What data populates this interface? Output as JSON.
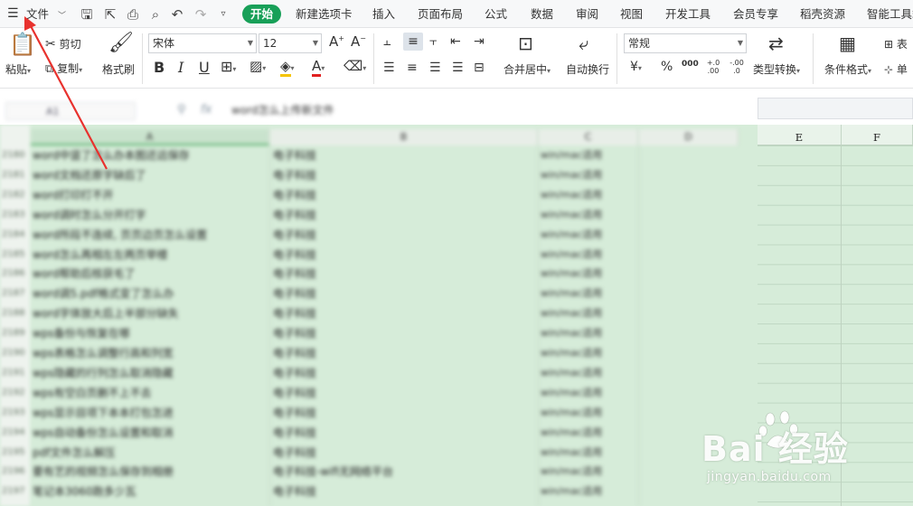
{
  "menubar": {
    "file_label": "文件",
    "tabs": [
      "开始",
      "新建选项卡",
      "插入",
      "页面布局",
      "公式",
      "数据",
      "审阅",
      "视图",
      "开发工具",
      "会员专享",
      "稻壳资源",
      "智能工具箱"
    ],
    "active_tab_color": "#18a058"
  },
  "ribbon": {
    "clipboard": {
      "paste": "粘贴",
      "cut": "剪切",
      "copy": "复制",
      "format_painter": "格式刷"
    },
    "font": {
      "family": "宋体",
      "size": "12",
      "bold": "B",
      "italic": "I",
      "underline": "U"
    },
    "alignment": {
      "merge_center": "合并居中",
      "wrap_text": "自动换行"
    },
    "number": {
      "format": "常规",
      "currency": "¥",
      "percent": "%",
      "thousands": "000",
      "inc_decimal": "+.0 .00",
      "dec_decimal": "-.00 .0",
      "type_convert": "类型转换"
    },
    "styles": {
      "conditional_format": "条件格式",
      "table_style": "表",
      "cell_style": "单"
    }
  },
  "formula": {
    "name_box": "A1",
    "fx": "fx",
    "content": "word怎么上传新文件"
  },
  "columns": {
    "blurred": [
      "A",
      "B",
      "C",
      "D"
    ],
    "visible": [
      "E",
      "F"
    ]
  },
  "rows": [
    {
      "n": "2180",
      "a": "word中竖了怎么办本图还远保存",
      "b": "电子科技",
      "c": "win/mac适用"
    },
    {
      "n": "2181",
      "a": "word文档还原字缺后了",
      "b": "电子科技",
      "c": "win/mac适用"
    },
    {
      "n": "2182",
      "a": "word打印打不开",
      "b": "电子科技",
      "c": "win/mac适用"
    },
    {
      "n": "2183",
      "a": "word调时怎么分开打字",
      "b": "电子科技",
      "c": "win/mac适用"
    },
    {
      "n": "2184",
      "a": "word所段不连续, 页页边页怎么设置",
      "b": "电子科技",
      "c": "win/mac适用"
    },
    {
      "n": "2185",
      "a": "word怎么再相左左两页举楼",
      "b": "电子科技",
      "c": "win/mac适用"
    },
    {
      "n": "2186",
      "a": "word帮助后核获毛了",
      "b": "电子科技",
      "c": "win/mac适用"
    },
    {
      "n": "2187",
      "a": "word调5.pdf格式变了怎么办",
      "b": "电子科技",
      "c": "win/mac适用"
    },
    {
      "n": "2188",
      "a": "word字体放大后上半部分缺失",
      "b": "电子科技",
      "c": "win/mac适用"
    },
    {
      "n": "2189",
      "a": "wps备份与恢复在哪",
      "b": "电子科技",
      "c": "win/mac适用"
    },
    {
      "n": "2190",
      "a": "wps表格怎么调整行高和列宽",
      "b": "电子科技",
      "c": "win/mac适用"
    },
    {
      "n": "2191",
      "a": "wps隐藏的行列怎么取消隐藏",
      "b": "电子科技",
      "c": "win/mac适用"
    },
    {
      "n": "2192",
      "a": "wps有空白页删不上不去",
      "b": "电子科技",
      "c": "win/mac适用"
    },
    {
      "n": "2193",
      "a": "wps显示目项下本本打包怎进",
      "b": "电子科技",
      "c": "win/mac适用"
    },
    {
      "n": "2194",
      "a": "wps自动备份怎么设置和取消",
      "b": "电子科技",
      "c": "win/mac适用"
    },
    {
      "n": "2195",
      "a": "pdf文件怎么解压",
      "b": "电子科技",
      "c": "win/mac适用"
    },
    {
      "n": "2196",
      "a": "要有艺的视频怎么保存到相册",
      "b": "电子科技-wifi无网络平台",
      "c": "win/mac适用"
    },
    {
      "n": "2197",
      "a": "笔记本3060跑多少瓦",
      "b": "电子科技",
      "c": "win/mac适用"
    }
  ],
  "watermark": {
    "main": "Bai 经验",
    "sub": "jingyan.baidu.com"
  },
  "annotation": {
    "color": "#e8322e"
  }
}
